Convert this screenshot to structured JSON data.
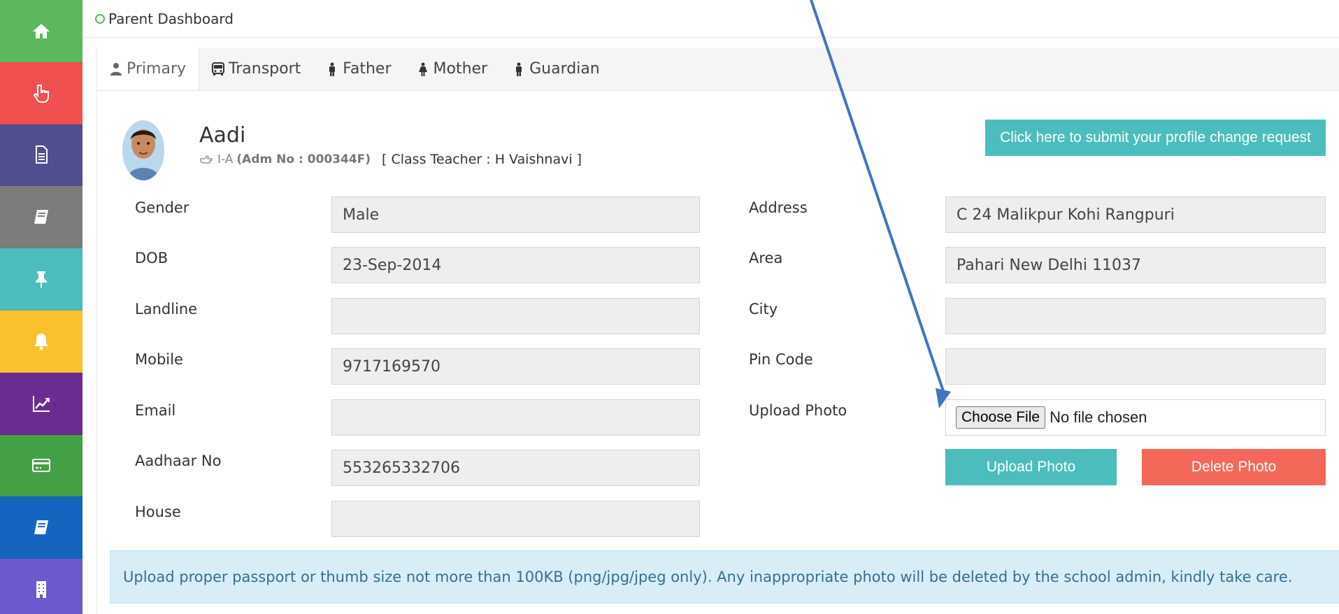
{
  "sidebar": {
    "items": [
      {
        "icon": "home-icon",
        "color": "#5cb85c"
      },
      {
        "icon": "hand-pointer-icon",
        "color": "#f0504f"
      },
      {
        "icon": "document-icon",
        "color": "#514f8f"
      },
      {
        "icon": "book-icon",
        "color": "#7b7d7d"
      },
      {
        "icon": "pin-icon",
        "color": "#4bbdbd"
      },
      {
        "icon": "bell-icon",
        "color": "#fbc02d"
      },
      {
        "icon": "chart-line-icon",
        "color": "#6a2c91"
      },
      {
        "icon": "credit-card-icon",
        "color": "#43a047"
      },
      {
        "icon": "book-icon",
        "color": "#1565c0"
      },
      {
        "icon": "building-icon",
        "color": "#6a5acd"
      }
    ]
  },
  "header": {
    "title": "Parent Dashboard"
  },
  "tabs": [
    {
      "label": "Primary",
      "icon": "user-icon"
    },
    {
      "label": "Transport",
      "icon": "bus-icon"
    },
    {
      "label": "Father",
      "icon": "male-icon"
    },
    {
      "label": "Mother",
      "icon": "female-icon"
    },
    {
      "label": "Guardian",
      "icon": "male-icon"
    }
  ],
  "student": {
    "name": "Aadi",
    "class": "I-A",
    "adm": "(Adm No : 000344F)",
    "teacher": "[ Class Teacher : H Vaishnavi ]"
  },
  "actions": {
    "change_request": "Click here to submit your profile change request",
    "upload_photo": "Upload Photo",
    "delete_photo": "Delete Photo"
  },
  "left_fields": [
    {
      "label": "Gender",
      "value": "Male"
    },
    {
      "label": "DOB",
      "value": "23-Sep-2014"
    },
    {
      "label": "Landline",
      "value": ""
    },
    {
      "label": "Mobile",
      "value": "9717169570"
    },
    {
      "label": "Email",
      "value": ""
    },
    {
      "label": "Aadhaar No",
      "value": "553265332706"
    },
    {
      "label": "House",
      "value": ""
    }
  ],
  "right_fields": [
    {
      "label": "Address",
      "value": "C 24 Malikpur Kohi Rangpuri"
    },
    {
      "label": "Area",
      "value": "Pahari New Delhi 11037"
    },
    {
      "label": "City",
      "value": ""
    },
    {
      "label": "Pin Code",
      "value": ""
    },
    {
      "label": "Upload Photo"
    }
  ],
  "file_input": {
    "button": "Choose File",
    "status": "No file chosen"
  },
  "notice": "Upload proper passport or thumb size not more than 100KB (png/jpg/jpeg only). Any inappropriate photo will be deleted by the school admin, kindly take care."
}
